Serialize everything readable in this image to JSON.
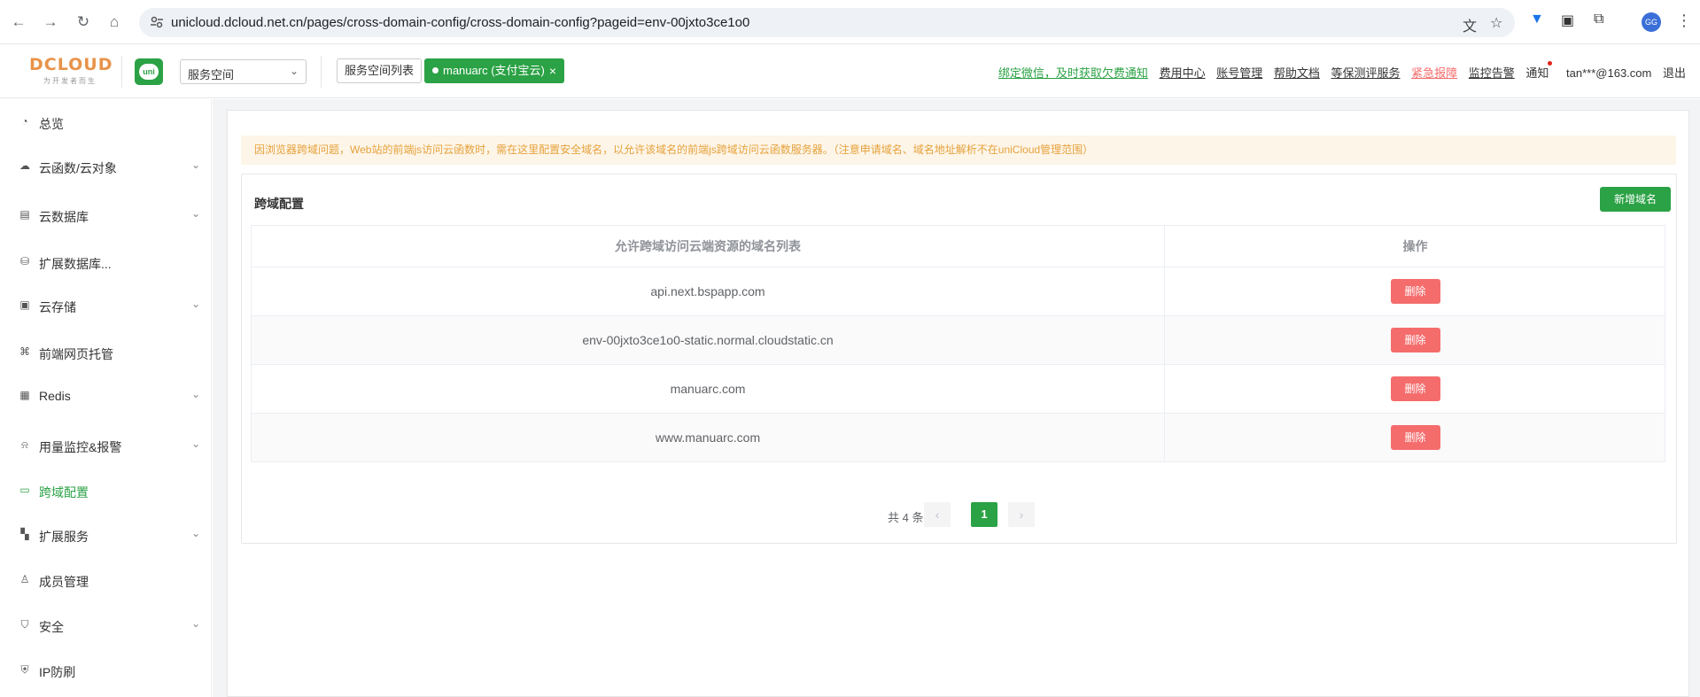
{
  "browser": {
    "url": "unicloud.dcloud.net.cn/pages/cross-domain-config/cross-domain-config?pageid=env-00jxto3ce1o0",
    "avatar_text": "GG"
  },
  "header": {
    "logo_text": "DCLOUD",
    "logo_sub": "为开发者而生",
    "uni_badge": "uni",
    "space_select": "服务空间",
    "space_list_btn": "服务空间列表",
    "active_space_tag": "manuarc (支付宝云)",
    "tag_close": "×",
    "links": {
      "wechat": "绑定微信，及时获取欠费通知",
      "billing": "费用中心",
      "account": "账号管理",
      "help": "帮助文档",
      "assessment": "等保测评服务",
      "report": "紧急报障",
      "alarm": "监控告警",
      "notify": "通知",
      "user": "tan***@163.com",
      "logout": "退出"
    }
  },
  "sidebar": {
    "items": [
      {
        "label": "总览",
        "icon": "pie-chart-icon"
      },
      {
        "label": "云函数/云对象",
        "icon": "cloud-icon"
      },
      {
        "label": "云数据库",
        "icon": "table-icon"
      },
      {
        "label": "扩展数据库...",
        "icon": "database-icon"
      },
      {
        "label": "云存储",
        "icon": "storage-icon"
      },
      {
        "label": "前端网页托管",
        "icon": "hosting-icon"
      },
      {
        "label": "Redis",
        "icon": "redis-icon"
      },
      {
        "label": "用量监控&报警",
        "icon": "alarm-icon"
      },
      {
        "label": "跨域配置",
        "icon": "cross-domain-icon"
      },
      {
        "label": "扩展服务",
        "icon": "grid-icon"
      },
      {
        "label": "成员管理",
        "icon": "user-icon"
      },
      {
        "label": "安全",
        "icon": "shield-icon"
      },
      {
        "label": "IP防刷",
        "icon": "ip-shield-icon"
      }
    ]
  },
  "main": {
    "notice": "因浏览器跨域问题，Web站的前端js访问云函数时，需在这里配置安全域名，以允许该域名的前端js跨域访问云函数服务器。（注意申请域名、域名地址解析不在uniCloud管理范围）",
    "panel_title": "跨域配置",
    "add_button": "新增域名",
    "table": {
      "headers": [
        "允许跨域访问云端资源的域名列表",
        "操作"
      ],
      "rows": [
        {
          "domain": "api.next.bspapp.com",
          "action": "删除"
        },
        {
          "domain": "env-00jxto3ce1o0-static.normal.cloudstatic.cn",
          "action": "删除"
        },
        {
          "domain": "manuarc.com",
          "action": "删除"
        },
        {
          "domain": "www.manuarc.com",
          "action": "删除"
        }
      ]
    },
    "pagination": {
      "total_text": "共 4 条",
      "prev": "‹",
      "current": "1",
      "next": "›"
    }
  }
}
